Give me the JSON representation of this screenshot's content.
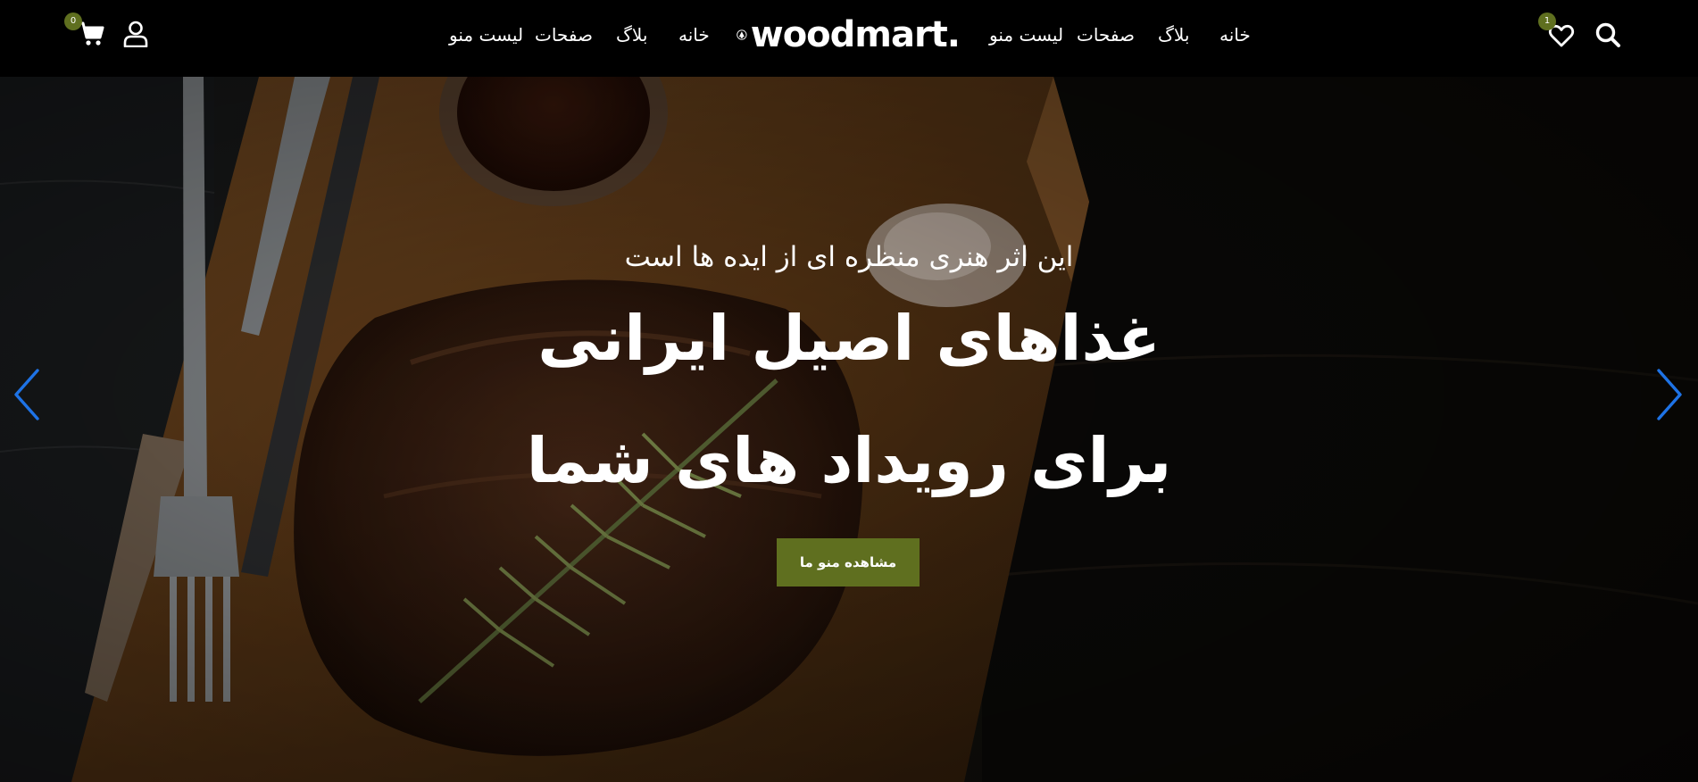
{
  "header": {
    "logo_text": "woodmart.",
    "nav_left": [
      {
        "label": "لیست منو"
      },
      {
        "label": "صفحات"
      },
      {
        "label": "بلاگ"
      },
      {
        "label": "خانه"
      }
    ],
    "nav_right": [
      {
        "label": "لیست منو"
      },
      {
        "label": "صفحات"
      },
      {
        "label": "بلاگ"
      },
      {
        "label": "خانه"
      }
    ],
    "cart_count": "0",
    "wishlist_count": "1"
  },
  "hero": {
    "subtitle": "این اثر هنری منظره ای از ایده ها است",
    "title_line1": "غذاهای اصیل ایرانی",
    "title_line2": "برای رویداد های شما",
    "cta_label": "مشاهده منو ما"
  },
  "colors": {
    "accent": "#5f6f1f",
    "arrow": "#1e73e6",
    "header_bg": "#000000"
  },
  "icons": [
    "cart-icon",
    "user-icon",
    "search-icon",
    "heart-icon",
    "chevron-left-icon",
    "chevron-right-icon",
    "logo-mark-icon"
  ]
}
